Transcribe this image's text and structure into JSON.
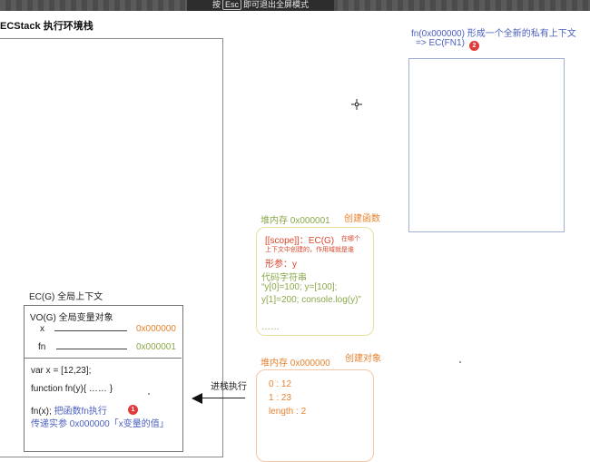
{
  "overlay": {
    "hint_prefix": "按",
    "hint_key": "Esc",
    "hint_suffix": "即可退出全屏模式"
  },
  "ecstack": {
    "title": "ECStack  执行环境栈"
  },
  "ecg": {
    "title": "EC(G) 全局上下文",
    "vo_title": "VO(G) 全局变量对象",
    "vars": [
      {
        "name": "x",
        "addr": "0x000000"
      },
      {
        "name": "fn",
        "addr": "0x000001"
      }
    ],
    "code": {
      "line1": "var x = [12,23];",
      "line2": "function fn(y){ …… }",
      "line3_code": "fn(x);",
      "line3_note": "把函数fn执行",
      "line4": "传递实参 0x000000「x变量的值」"
    },
    "badge": "1"
  },
  "exec_arrow": {
    "label": "进栈执行"
  },
  "heap_fn": {
    "title": "堆内存 0x000001",
    "note": "创建函数",
    "scope_line": "[[scope]]：EC(G)",
    "scope_note1": "在哪个",
    "scope_note2": "上下文中创建的，作用域就是谁",
    "params": "形参：y",
    "code_title": "代码字符串",
    "code1": "“y[0]=100; y=[100];",
    "code2": "y[1]=200; console.log(y)”",
    "ellipsis": "……"
  },
  "heap_obj": {
    "title": "堆内存 0x000000",
    "note": "创建对象",
    "props": [
      "0 : 12",
      "1 : 23",
      "length : 2"
    ]
  },
  "fn_context": {
    "line1": "fn(0x000000) 形成一个全新的私有上下文",
    "line2": "=> EC(FN1)",
    "badge": "2"
  },
  "colors": {
    "orange": "#e8822e",
    "olive": "#8aa84a",
    "blue": "#4a5fc1",
    "red": "#d9462b",
    "badge": "#e23b3b"
  }
}
